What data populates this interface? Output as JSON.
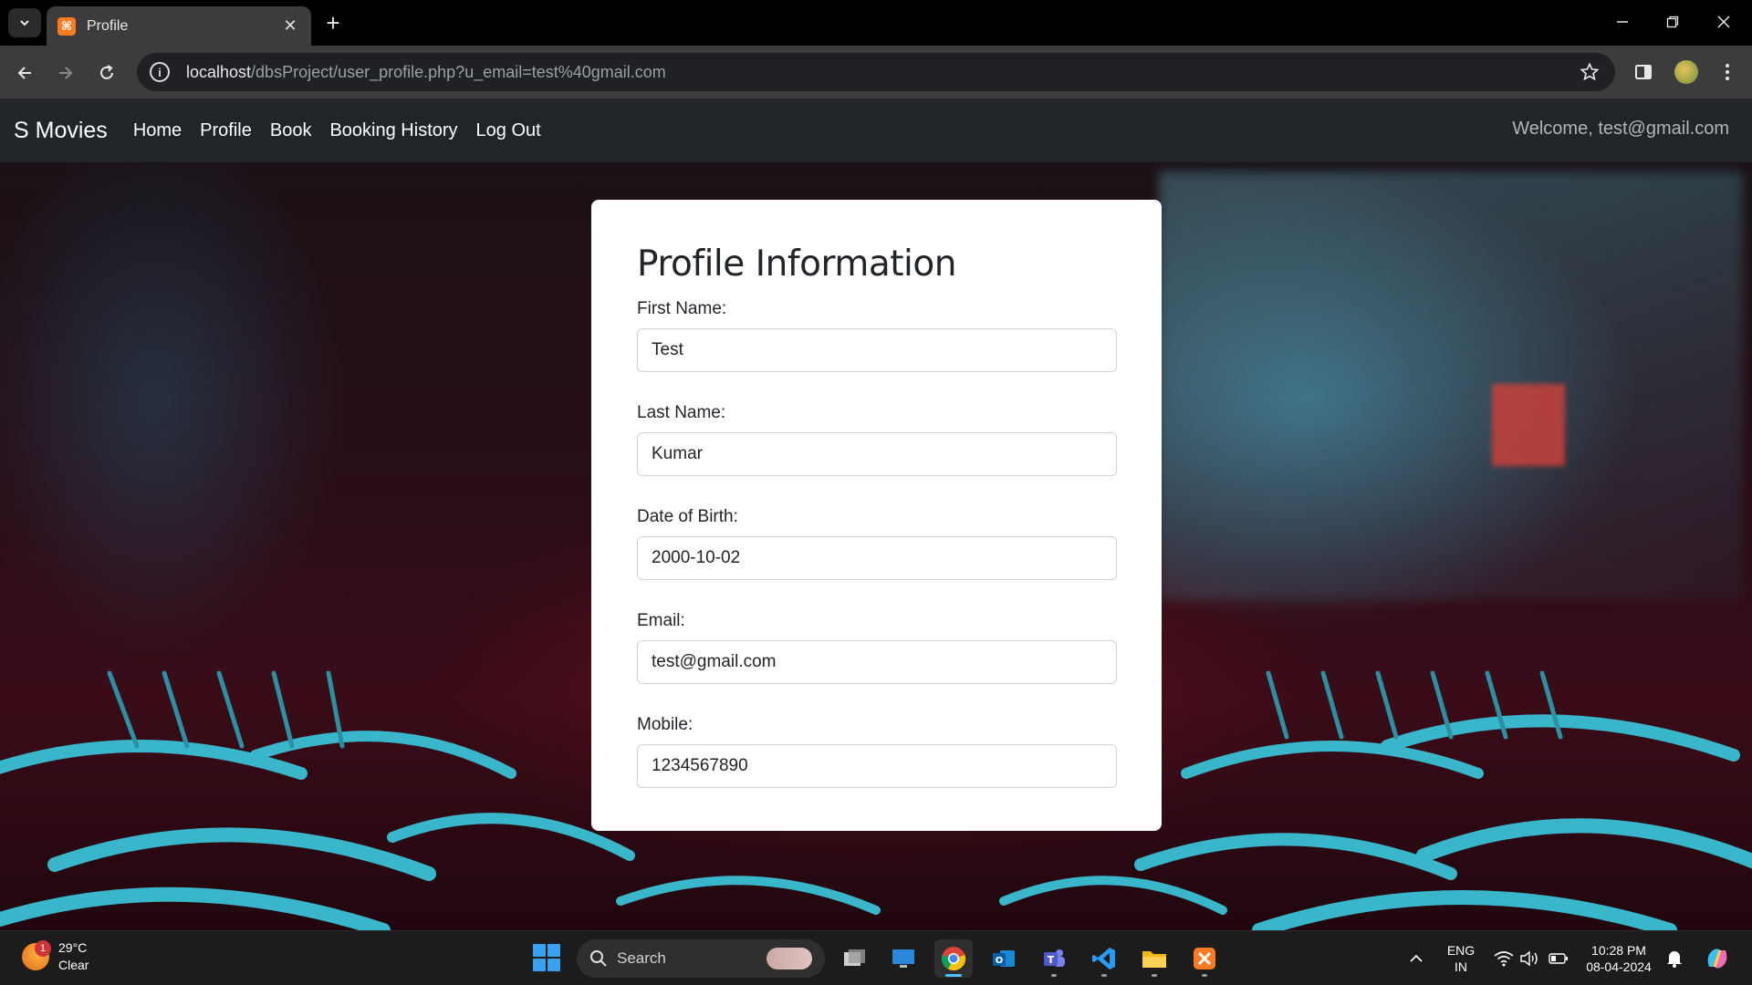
{
  "browser": {
    "tab": {
      "title": "Profile",
      "favicon": "xampp-icon"
    },
    "url_host": "localhost",
    "url_path": "/dbsProject/user_profile.php?u_email=test%40gmail.com"
  },
  "navbar": {
    "brand": "S Movies",
    "links": [
      "Home",
      "Profile",
      "Book",
      "Booking History",
      "Log Out"
    ],
    "welcome": "Welcome, test@gmail.com"
  },
  "profile": {
    "title": "Profile Information",
    "fields": [
      {
        "label": "First Name:",
        "value": "Test"
      },
      {
        "label": "Last Name:",
        "value": "Kumar"
      },
      {
        "label": "Date of Birth:",
        "value": "2000-10-02"
      },
      {
        "label": "Email:",
        "value": "test@gmail.com"
      },
      {
        "label": "Mobile:",
        "value": "1234567890"
      }
    ]
  },
  "taskbar": {
    "weather": {
      "temp": "29°C",
      "condition": "Clear",
      "badge": "1"
    },
    "search_label": "Search",
    "language": {
      "line1": "ENG",
      "line2": "IN"
    },
    "time": "10:28 PM",
    "date": "08-04-2024"
  },
  "colors": {
    "navbar_bg": "#212529",
    "browser_toolbar": "#3c3c3c",
    "accent_windows": "#4cc2ff"
  }
}
